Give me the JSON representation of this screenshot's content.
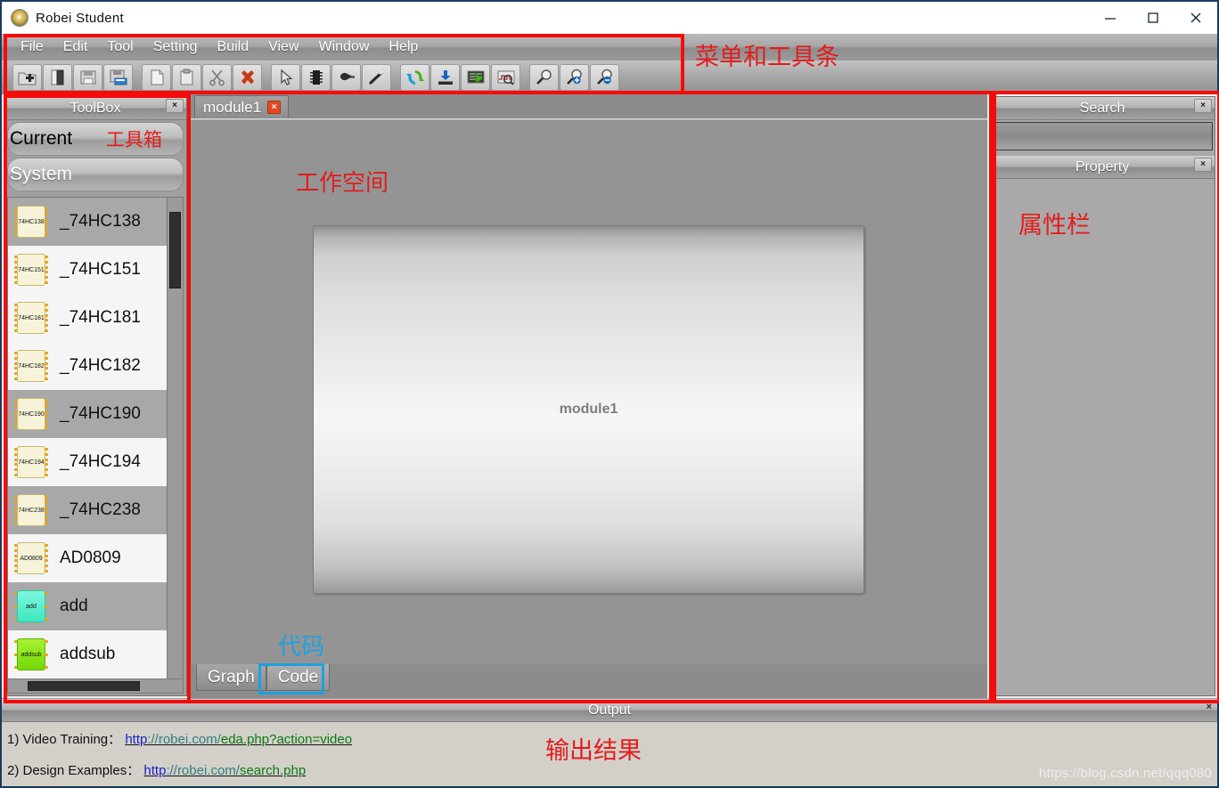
{
  "window": {
    "title": "Robei  Student",
    "icon": "robei-logo-icon",
    "controls": {
      "minimize": "minimize-icon",
      "maximize": "maximize-icon",
      "close": "close-icon"
    }
  },
  "menubar": {
    "items": [
      "File",
      "Edit",
      "Tool",
      "Setting",
      "Build",
      "View",
      "Window",
      "Help"
    ]
  },
  "toolbar": {
    "buttons": [
      {
        "name": "new-project-icon",
        "tip": "New"
      },
      {
        "name": "open-folder-icon",
        "tip": "Open"
      },
      {
        "name": "save-icon",
        "tip": "Save"
      },
      {
        "name": "save-as-icon",
        "tip": "Save As"
      },
      {
        "name": "copy-icon",
        "tip": "Copy"
      },
      {
        "name": "paste-icon",
        "tip": "Paste"
      },
      {
        "name": "cut-scissors-icon",
        "tip": "Cut"
      },
      {
        "name": "delete-red-x-icon",
        "tip": "Delete"
      },
      {
        "name": "select-arrow-icon",
        "tip": "Select"
      },
      {
        "name": "chip-module-icon",
        "tip": "Module"
      },
      {
        "name": "port-plug-icon",
        "tip": "Port"
      },
      {
        "name": "wire-line-icon",
        "tip": "Wire"
      },
      {
        "name": "compile-refresh-icon",
        "tip": "Compile"
      },
      {
        "name": "download-icon",
        "tip": "Download"
      },
      {
        "name": "run-simulate-icon",
        "tip": "Simulate"
      },
      {
        "name": "waveform-view-icon",
        "tip": "View Wave"
      },
      {
        "name": "zoom-normal-icon",
        "tip": "Zoom"
      },
      {
        "name": "zoom-in-icon",
        "tip": "Zoom In"
      },
      {
        "name": "zoom-out-icon",
        "tip": "Zoom Out"
      }
    ]
  },
  "toolbox": {
    "title": "ToolBox",
    "close_label": "×",
    "annotation": "工具箱",
    "groups": [
      {
        "label": "Current",
        "expanded": false
      },
      {
        "label": "System",
        "expanded": true
      }
    ],
    "components": [
      {
        "label": "_74HC138",
        "icon_text": "74HC138",
        "icon_style": "ic"
      },
      {
        "label": "_74HC151",
        "icon_text": "74HC151",
        "icon_style": "ic"
      },
      {
        "label": "_74HC181",
        "icon_text": "74HC181",
        "icon_style": "ic"
      },
      {
        "label": "_74HC182",
        "icon_text": "74HC182",
        "icon_style": "ic"
      },
      {
        "label": "_74HC190",
        "icon_text": "74HC190",
        "icon_style": "ic"
      },
      {
        "label": "_74HC194",
        "icon_text": "74HC194",
        "icon_style": "ic"
      },
      {
        "label": "_74HC238",
        "icon_text": "74HC238",
        "icon_style": "ic"
      },
      {
        "label": "AD0809",
        "icon_text": "AD0809",
        "icon_style": "ic"
      },
      {
        "label": "add",
        "icon_text": "add",
        "icon_style": "teal"
      },
      {
        "label": "addsub",
        "icon_text": "addsub",
        "icon_style": "green"
      }
    ]
  },
  "editor": {
    "tabs": [
      {
        "label": "module1",
        "close_label": "×",
        "active": true
      }
    ],
    "annotation_workspace": "工作空间",
    "block": {
      "label": "module1"
    },
    "bottom_tabs": [
      {
        "label": "Graph",
        "active": false
      },
      {
        "label": "Code",
        "active": true,
        "highlighted": true
      }
    ],
    "annotation_code": "代码"
  },
  "search_panel": {
    "title": "Search",
    "close_label": "×",
    "input_value": "",
    "input_placeholder": ""
  },
  "property_panel": {
    "title": "Property",
    "close_label": "×",
    "annotation": "属性栏"
  },
  "output_panel": {
    "title": "Output",
    "close_label": "×",
    "annotation": "输出结果",
    "lines": [
      {
        "prefix": "1) Video Training：",
        "url_parts": [
          "http",
          "://robei.com/",
          "eda.php?action=video"
        ],
        "url_full": "http://robei.com/eda.php?action=video"
      },
      {
        "prefix": "2) Design Examples：",
        "url_parts": [
          "http",
          "://robei.com/",
          "search.php"
        ],
        "url_full": "http://robei.com/search.php"
      }
    ]
  },
  "annotations": {
    "menu_toolbar": "菜单和工具条",
    "accent_red": "#f60b0b",
    "accent_blue": "#1ba1e2"
  },
  "watermark": {
    "text": "https://blog.csdn.net/qqq080"
  }
}
